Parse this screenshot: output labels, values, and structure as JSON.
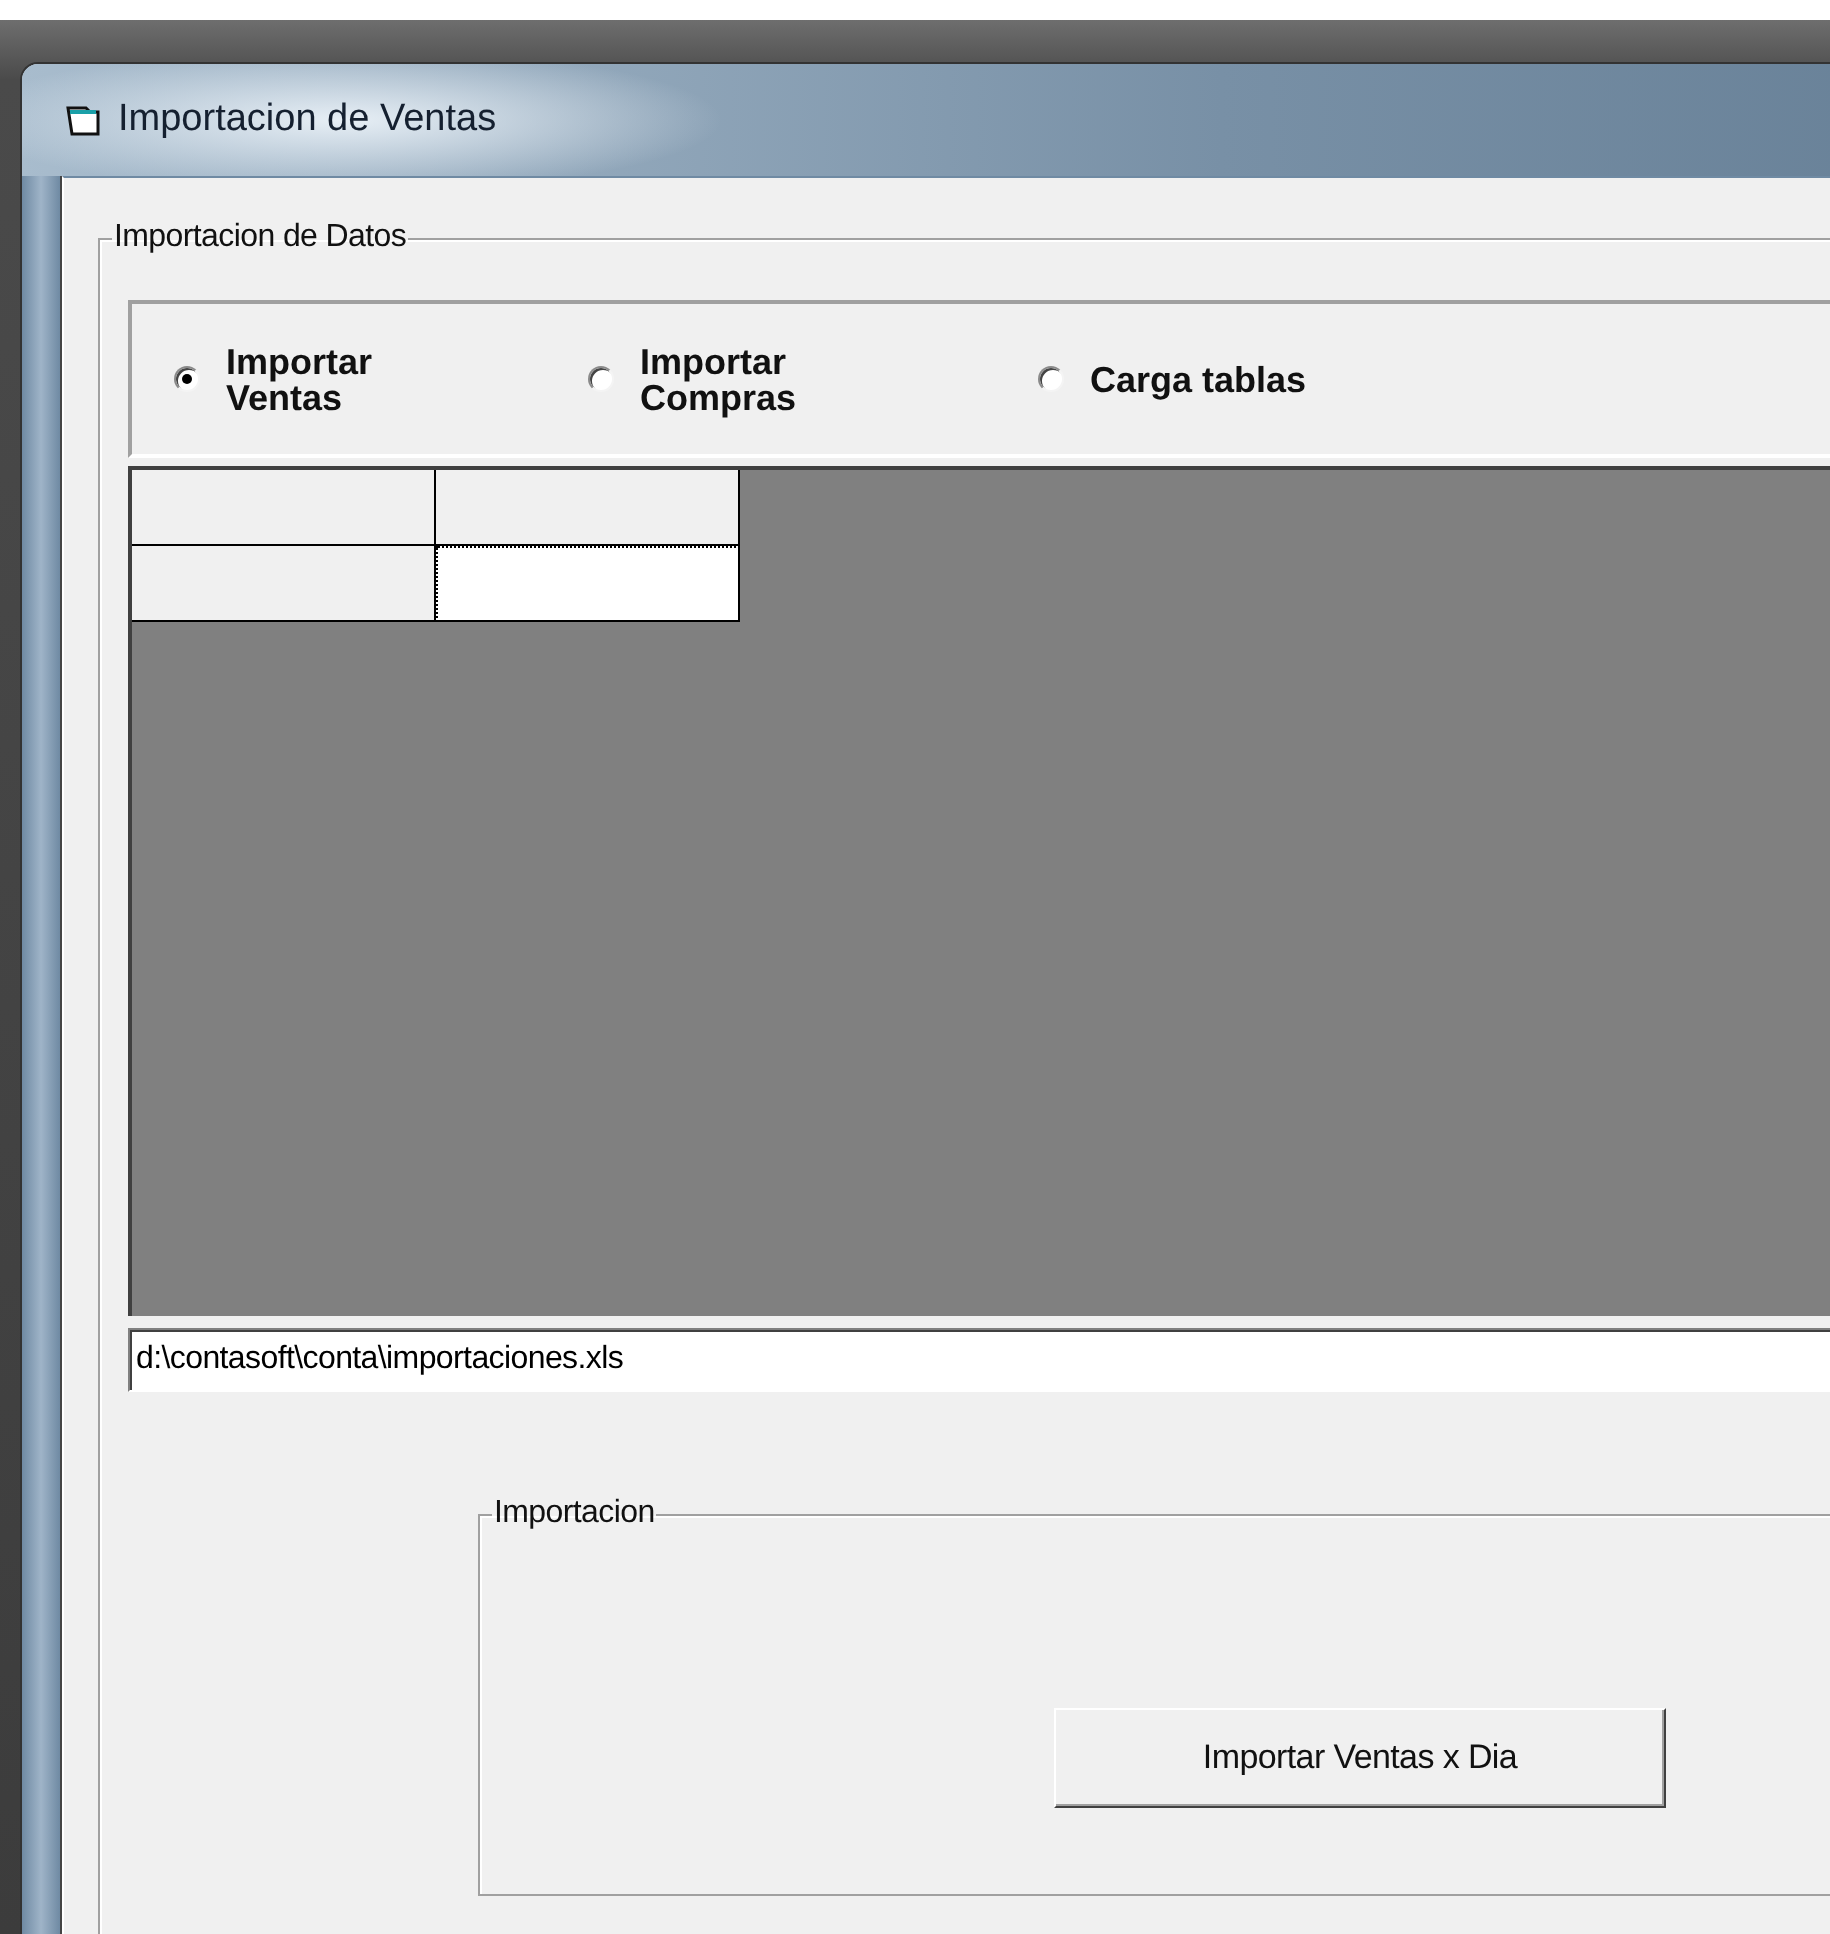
{
  "window": {
    "title": "Importacion de Ventas"
  },
  "data_group": {
    "label": "Importacion de Datos",
    "options": [
      {
        "label": "Importar\nVentas",
        "selected": true
      },
      {
        "label": "Importar\nCompras",
        "selected": false
      },
      {
        "label": "Carga tablas",
        "selected": false
      }
    ],
    "grid": {
      "rows": [
        {
          "cells": [
            {
              "selected": false
            },
            {
              "selected": false
            }
          ]
        },
        {
          "cells": [
            {
              "selected": false
            },
            {
              "selected": true
            }
          ]
        }
      ]
    },
    "file_path": {
      "value": "d:\\contasoft\\conta\\importaciones.xls"
    }
  },
  "import_group": {
    "label": "Importacion",
    "button": "Importar Ventas x Dia"
  }
}
